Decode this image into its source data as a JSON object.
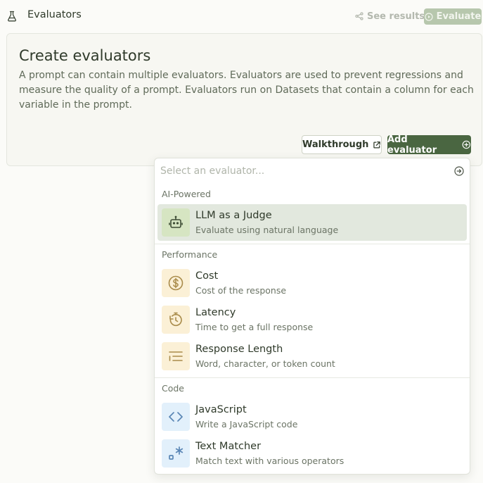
{
  "header": {
    "title": "Evaluators",
    "see_results": "See results",
    "evaluate": "Evaluate"
  },
  "panel": {
    "title": "Create evaluators",
    "description": "A prompt can contain multiple evaluators. Evaluators are used to prevent regressions and measure the quality of a prompt. Evaluators run on Datasets that contain a column for each variable in the prompt.",
    "walkthrough": "Walkthrough",
    "add_evaluator": "Add evaluator"
  },
  "dropdown": {
    "placeholder": "Select an evaluator...",
    "sections": [
      {
        "label": "AI-Powered",
        "items": [
          {
            "title": "LLM as a Judge",
            "subtitle": "Evaluate using natural language",
            "icon": "robot-icon"
          }
        ]
      },
      {
        "label": "Performance",
        "items": [
          {
            "title": "Cost",
            "subtitle": "Cost of the response",
            "icon": "dollar-icon"
          },
          {
            "title": "Latency",
            "subtitle": "Time to get a full response",
            "icon": "timer-icon"
          },
          {
            "title": "Response Length",
            "subtitle": "Word, character, or token count",
            "icon": "text-lines-icon"
          }
        ]
      },
      {
        "label": "Code",
        "items": [
          {
            "title": "JavaScript",
            "subtitle": "Write a JavaScript code",
            "icon": "code-brackets-icon"
          },
          {
            "title": "Text Matcher",
            "subtitle": "Match text with various operators",
            "icon": "regex-icon"
          }
        ]
      }
    ]
  },
  "colors": {
    "primary": "#4a6641",
    "disabled_primary": "#b7c7ad",
    "selected_row": "#e2e8de",
    "icon_green_bg": "#d6e5c2",
    "icon_amber_bg": "#fbf0d6",
    "icon_blue_bg": "#e2f0fb"
  }
}
